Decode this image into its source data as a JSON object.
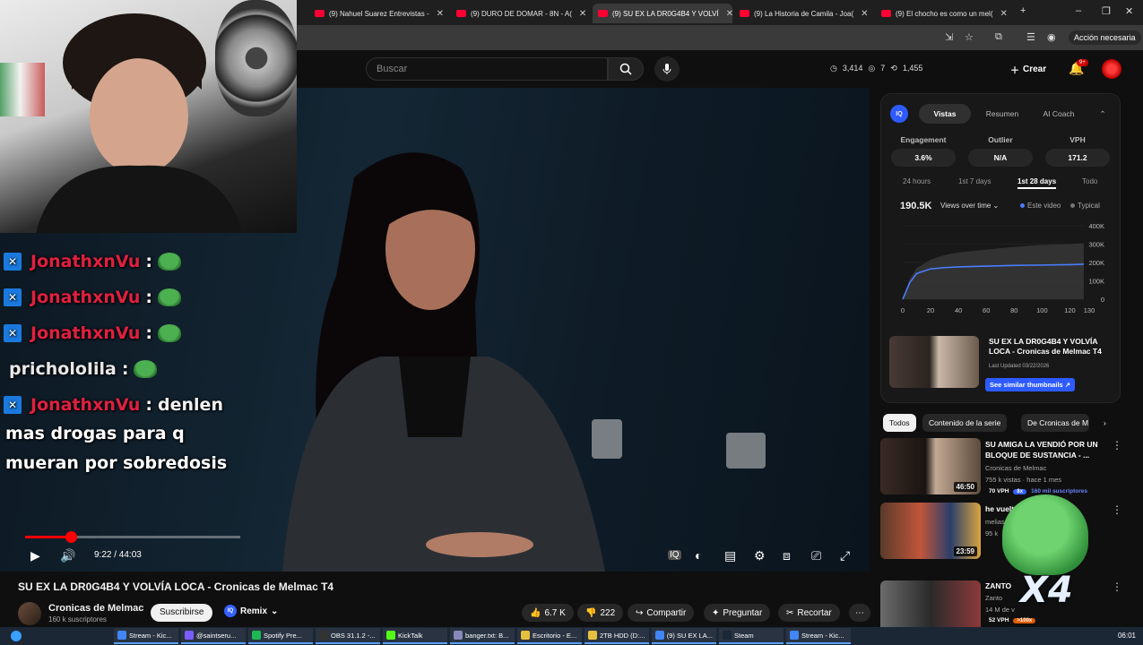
{
  "browser": {
    "tabs": [
      {
        "label": "(9) Nahuel Suarez Entrevistas -",
        "active": false
      },
      {
        "label": "(9) DURO DE DOMAR - 8N - A(",
        "active": false
      },
      {
        "label": "(9) SU EX LA DR0G4B4 Y VOLVÍ",
        "active": true
      },
      {
        "label": "(9) La Historia de Camila - Joa(",
        "active": false
      },
      {
        "label": "(9) El chocho es como un mel(",
        "active": false
      }
    ],
    "new_tab": "+",
    "window_controls": [
      "–",
      "❐",
      "✕"
    ],
    "accion_necesaria": "Acción necesaria"
  },
  "youtube_header": {
    "search_placeholder": "Buscar",
    "stats": {
      "viewers": "3,414",
      "watching": "7",
      "likes": "1,455"
    },
    "create_label": "Crear",
    "notif_count": "9+"
  },
  "chat": {
    "lines": [
      {
        "user": "JonathxnVu",
        "badge": "kick",
        "emote": "pepe"
      },
      {
        "user": "JonathxnVu",
        "badge": "kick",
        "emote": "pepe"
      },
      {
        "user": "JonathxnVu",
        "badge": "kick",
        "emote": "pepe"
      },
      {
        "user": "pricholoIila",
        "badge": "none",
        "emote": "pepe-headphones"
      }
    ],
    "last": {
      "user": "JonathxnVu",
      "text_first": "denlen",
      "text_rest": "mas drogas para q mueran por sobredosis"
    }
  },
  "player": {
    "current_time": "9:22",
    "duration": "44:03",
    "time_display": "9:22 / 44:03",
    "progress_fraction": 0.2127
  },
  "video": {
    "title": "SU EX LA DR0G4B4 Y VOLVÍA LOCA - Cronicas de Melmac T4",
    "channel": "Cronicas de Melmac",
    "subs": "160 k suscriptores",
    "subscribe_label": "Suscribirse",
    "remix_label": "Remix",
    "likes": "6.7 K",
    "dislikes": "222",
    "share_label": "Compartir",
    "ask_label": "Preguntar",
    "clip_label": "Recortar"
  },
  "iq_panel": {
    "logo": "IQ",
    "tabs": [
      "Vistas",
      "Resumen",
      "AI Coach"
    ],
    "active_tab": "Vistas",
    "metrics": [
      {
        "label": "Engagement",
        "value": "3.6%"
      },
      {
        "label": "Outlier",
        "value": "N/A"
      },
      {
        "label": "VPH",
        "value": "171.2"
      }
    ],
    "ranges": [
      "24 hours",
      "1st 7 days",
      "1st 28 days",
      "Todo"
    ],
    "active_range": "1st 28 days",
    "views_total": "190.5K",
    "views_dropdown": "Views over time",
    "legend_this": "Este video",
    "legend_typical": "Typical",
    "thumbnail_title": "SU EX LA DR0G4B4 Y VOLVÍA LOCA - Cronicas de Melmac T4",
    "last_updated": "Last Updated 03/22/2026",
    "similar_label": "See similar thumbnails ↗"
  },
  "chart_data": {
    "type": "line",
    "x_ticks": [
      "0",
      "20",
      "40",
      "60",
      "80",
      "100",
      "120",
      "130"
    ],
    "y_ticks": [
      "400K",
      "300K",
      "200K",
      "100K",
      "0"
    ],
    "ylim": [
      0,
      400000
    ],
    "xlim": [
      0,
      130
    ],
    "series": [
      {
        "name": "Este video",
        "x": [
          0,
          5,
          10,
          20,
          30,
          40,
          60,
          80,
          100,
          120,
          130
        ],
        "y": [
          0,
          90000,
          140000,
          165000,
          172000,
          176000,
          180000,
          184000,
          186000,
          188000,
          190500
        ]
      },
      {
        "name": "Typical",
        "x": [
          0,
          5,
          10,
          20,
          30,
          40,
          60,
          80,
          100,
          120,
          130
        ],
        "y": [
          0,
          110000,
          170000,
          215000,
          240000,
          255000,
          270000,
          285000,
          295000,
          300000,
          305000
        ]
      }
    ]
  },
  "chips": [
    "Todos",
    "Contenido de la serie",
    "De Cronicas de M"
  ],
  "active_chip": "Todos",
  "recommendations": [
    {
      "title": "SU AMIGA LA VENDIÓ POR UN BLOQUE DE SUSTANCIA - ...",
      "channel": "Cronicas de Melmac",
      "meta": "755 k vistas · hace 1 mes",
      "duration": "46:50",
      "vph": "70 VPH",
      "pill": "8x",
      "subs": "160 mil suscriptores"
    },
    {
      "title": "he vuelto",
      "channel": "melias",
      "meta": "95 k",
      "duration": "23:59",
      "vph": "",
      "pill": "",
      "subs": ""
    },
    {
      "title": "ZANTO",
      "channel": "Zanto",
      "meta": "14 M de v",
      "duration": "",
      "vph": "52 VPH",
      "pill": ">100x",
      "subs": ""
    }
  ],
  "overlay": {
    "multiplier": "X4"
  },
  "taskbar": {
    "items": [
      "Stream - Kic...",
      "@saintseru...",
      "Spotify Pre...",
      "OBS 31.1.2 -...",
      "KickTalk",
      "banger.txt: B...",
      "Escritorio - E...",
      "2TB HDD (D:...",
      "(9) SU EX LA...",
      "Steam",
      "Stream - Kic..."
    ],
    "clock": "06:01"
  },
  "colors": {
    "accent_red": "#ff0000",
    "iq_blue": "#2e5bff",
    "chat_red": "#e02040"
  }
}
